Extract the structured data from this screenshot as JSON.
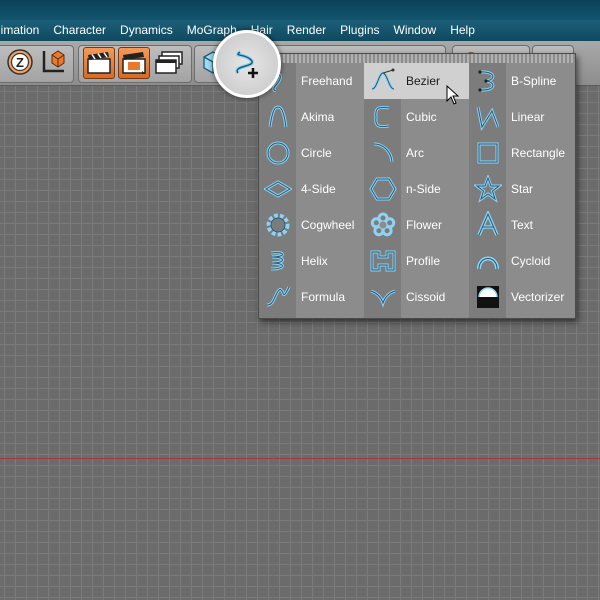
{
  "menubar": {
    "items": [
      "nimation",
      "Character",
      "Dynamics",
      "MoGraph",
      "Hair",
      "Render",
      "Plugins",
      "Window",
      "Help"
    ]
  },
  "toolbar": {
    "buttons": [
      "z-axis-lock-icon",
      "coordinate-system-icon",
      "render-view-icon",
      "render-picture-icon",
      "render-settings-icon",
      "cube-icon",
      "spline-tool-icon"
    ]
  },
  "spline_menu": {
    "columns": [
      [
        "Freehand",
        "Akima",
        "Circle",
        "4-Side",
        "Cogwheel",
        "Helix",
        "Formula"
      ],
      [
        "Bezier",
        "Cubic",
        "Arc",
        "n-Side",
        "Flower",
        "Profile",
        "Cissoid"
      ],
      [
        "B-Spline",
        "Linear",
        "Rectangle",
        "Star",
        "Text",
        "Cycloid",
        "Vectorizer"
      ]
    ],
    "selected": "Bezier",
    "icon_color": "#8fd3f4"
  }
}
